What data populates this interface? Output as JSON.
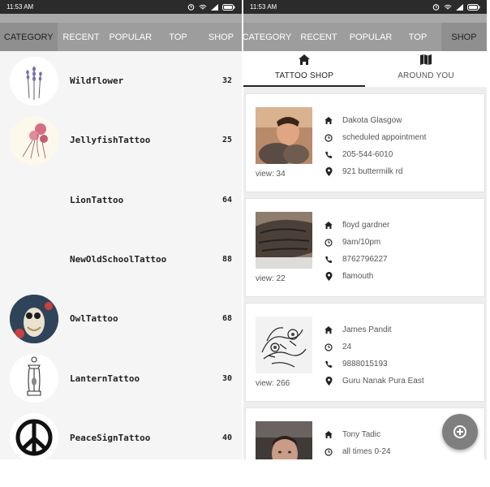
{
  "left": {
    "status_time": "11:53 AM",
    "tabs": [
      {
        "label": "CATEGORY",
        "active": true
      },
      {
        "label": "RECENT",
        "active": false
      },
      {
        "label": "POPULAR",
        "active": false
      },
      {
        "label": "TOP",
        "active": false
      },
      {
        "label": "SHOP",
        "active": false
      }
    ],
    "categories": [
      {
        "name": "Wildflower",
        "count": "32",
        "thumb": "lavender-sketch"
      },
      {
        "name": "JellyfishTattoo",
        "count": "25",
        "thumb": "jellyfish-art"
      },
      {
        "name": "LionTattoo",
        "count": "64",
        "thumb": "none"
      },
      {
        "name": "NewOldSchoolTattoo",
        "count": "88",
        "thumb": "none"
      },
      {
        "name": "OwlTattoo",
        "count": "68",
        "thumb": "owl-art"
      },
      {
        "name": "LanternTattoo",
        "count": "30",
        "thumb": "lantern-sketch"
      },
      {
        "name": "PeaceSignTattoo",
        "count": "40",
        "thumb": "peace-sign"
      }
    ]
  },
  "right": {
    "status_time": "11:53 AM",
    "tabs": [
      {
        "label": "CATEGORY",
        "active": false
      },
      {
        "label": "RECENT",
        "active": false
      },
      {
        "label": "POPULAR",
        "active": false
      },
      {
        "label": "TOP",
        "active": false
      },
      {
        "label": "SHOP",
        "active": true
      }
    ],
    "subtabs": [
      {
        "label": "TATTOO SHOP",
        "icon": "home-icon",
        "active": true
      },
      {
        "label": "AROUND YOU",
        "icon": "map-icon",
        "active": false
      }
    ],
    "shops": [
      {
        "name": "Dakota Glasgow",
        "hours": "scheduled appointment",
        "phone": "205-544-6010",
        "address": "921 buttermilk rd",
        "views": "view: 34",
        "photo": "man-with-cat"
      },
      {
        "name": "floyd gardner",
        "hours": "9am/10pm",
        "phone": "8762796227",
        "address": "flamouth",
        "views": "view: 22",
        "photo": "tattooed-arm"
      },
      {
        "name": "James Pandit",
        "hours": "24",
        "phone": "9888015193",
        "address": "Guru Nanak Pura East",
        "views": "view: 266",
        "photo": "dragon-sketch"
      },
      {
        "name": "Tony Tadic",
        "hours": "all times 0-24",
        "phone": "",
        "address": "",
        "views": "",
        "photo": "man-selfie"
      }
    ]
  },
  "colors": {
    "tabbar": "#9d9d9d",
    "statusbar": "#2b2b2b",
    "fab": "#7f7f7f"
  }
}
